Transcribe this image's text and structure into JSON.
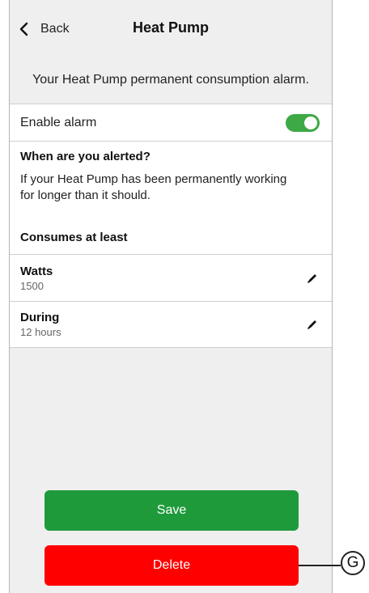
{
  "header": {
    "back_label": "Back",
    "title": "Heat Pump"
  },
  "description": "Your Heat Pump permanent consumption alarm.",
  "enable_alarm": {
    "label": "Enable alarm",
    "enabled": true,
    "toggle_color": "#3da945"
  },
  "info": {
    "heading": "When are you alerted?",
    "text": "If your Heat Pump has been permanently working for longer than it should.",
    "consumes_heading": "Consumes at least"
  },
  "params": {
    "watts": {
      "name": "Watts",
      "value": "1500",
      "icon": "pencil-icon"
    },
    "during": {
      "name": "During",
      "value": "12 hours",
      "icon": "pencil-icon"
    }
  },
  "buttons": {
    "save_label": "Save",
    "save_color": "#1f9a3b",
    "delete_label": "Delete",
    "delete_color": "#ff0000"
  },
  "callout": {
    "label": "G"
  }
}
